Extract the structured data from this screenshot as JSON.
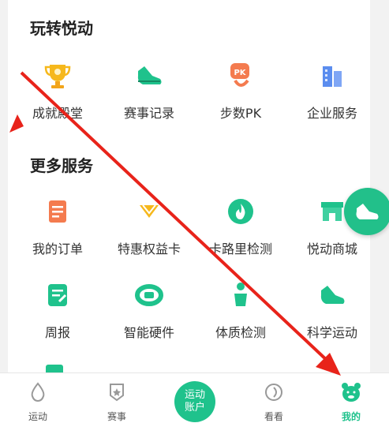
{
  "sections": {
    "play": {
      "title": "玩转悦动",
      "items": [
        {
          "label": "成就殿堂",
          "icon": "trophy-icon"
        },
        {
          "label": "赛事记录",
          "icon": "running-shoe-icon"
        },
        {
          "label": "步数PK",
          "icon": "pk-icon"
        },
        {
          "label": "企业服务",
          "icon": "building-icon"
        }
      ]
    },
    "more": {
      "title": "更多服务",
      "items": [
        {
          "label": "我的订单",
          "icon": "order-icon"
        },
        {
          "label": "特惠权益卡",
          "icon": "card-icon"
        },
        {
          "label": "卡路里检测",
          "icon": "flame-icon"
        },
        {
          "label": "悦动商城",
          "icon": "shop-icon"
        },
        {
          "label": "周报",
          "icon": "report-icon"
        },
        {
          "label": "智能硬件",
          "icon": "band-icon"
        },
        {
          "label": "体质检测",
          "icon": "body-icon"
        },
        {
          "label": "科学运动",
          "icon": "sneaker-icon"
        }
      ]
    }
  },
  "tabbar": {
    "tabs": [
      {
        "label": "运动",
        "icon": "drop-icon"
      },
      {
        "label": "赛事",
        "icon": "badge-icon"
      },
      {
        "label": "看看",
        "icon": "swirl-icon"
      },
      {
        "label": "我的",
        "icon": "bear-icon"
      }
    ],
    "center_label": "运动\n账户",
    "active_color": "#1fc28c"
  },
  "colors": {
    "accent": "#1fc28c",
    "annotation": "#e8231a"
  }
}
